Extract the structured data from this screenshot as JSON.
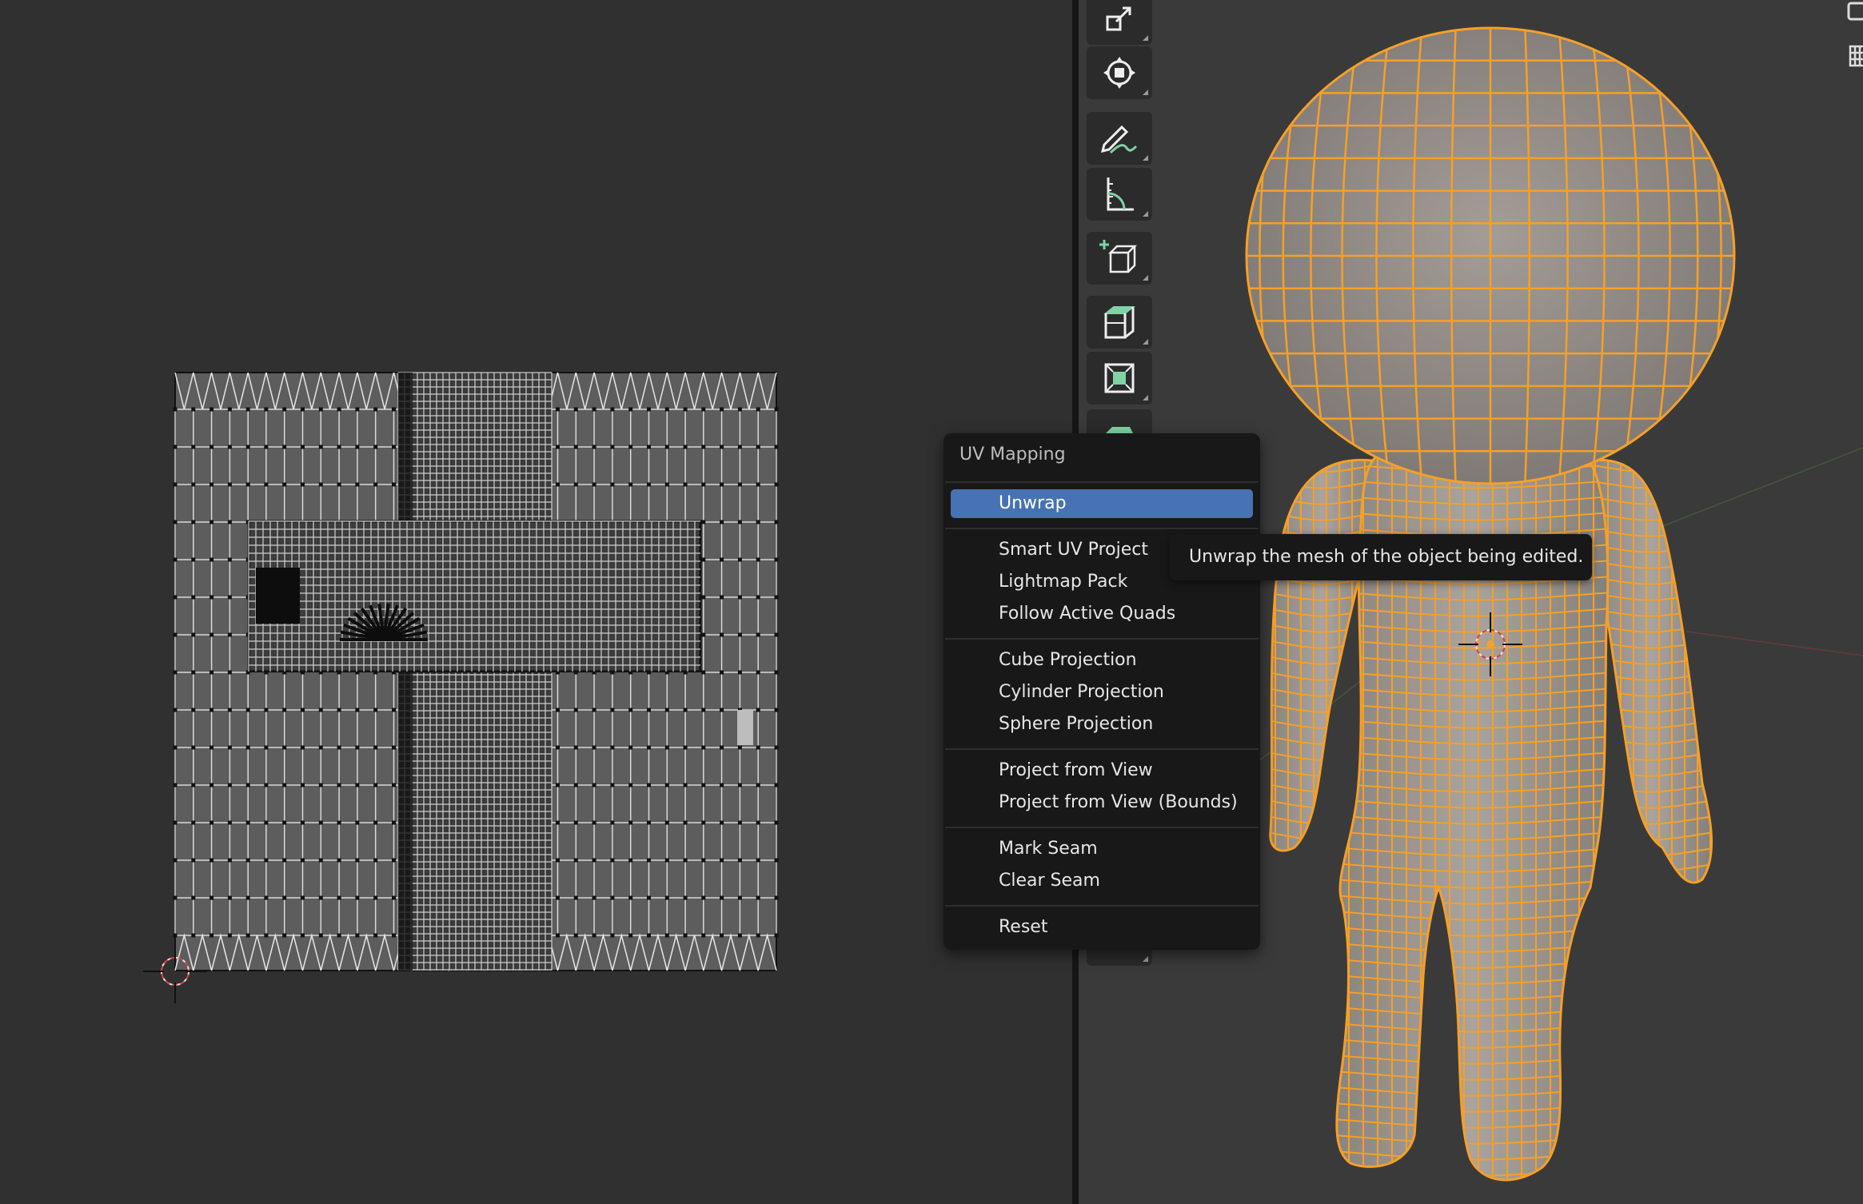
{
  "menu": {
    "title": "UV Mapping",
    "items": [
      {
        "label": "Unwrap",
        "active": true
      },
      {
        "label": "Smart UV Project"
      },
      {
        "label": "Lightmap Pack"
      },
      {
        "label": "Follow Active Quads"
      },
      {
        "label": "Cube Projection"
      },
      {
        "label": "Cylinder Projection"
      },
      {
        "label": "Sphere Projection"
      },
      {
        "label": "Project from View"
      },
      {
        "label": "Project from View (Bounds)"
      },
      {
        "label": "Mark Seam"
      },
      {
        "label": "Clear Seam"
      },
      {
        "label": "Reset"
      }
    ]
  },
  "tooltip": {
    "text": "Unwrap the mesh of the object being edited."
  },
  "toolbar": {
    "tools": [
      "scale-icon",
      "transform-icon",
      "annotate-icon",
      "measure-icon",
      "add-cube-icon",
      "extrude-icon",
      "inset-icon",
      "bevel-icon"
    ]
  },
  "colors": {
    "accent": "#4772b3",
    "mesh_wire": "#f5a028",
    "tool_green": "#7fd3a5",
    "background": "#303030"
  }
}
